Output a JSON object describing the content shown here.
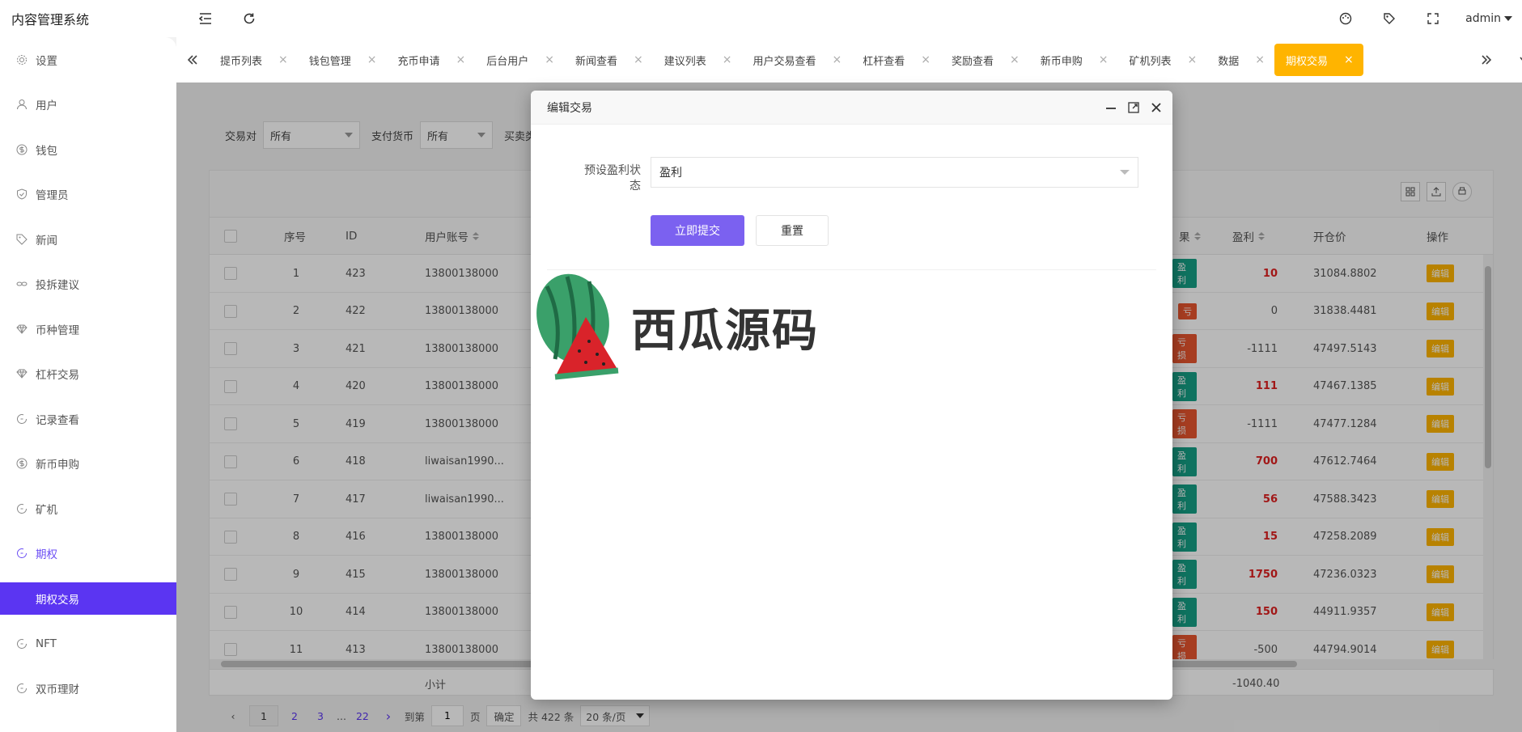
{
  "app": {
    "title": "内容管理系统",
    "user": "admin"
  },
  "sidebar": {
    "items": [
      {
        "label": "设置",
        "icon": "gear-icon"
      },
      {
        "label": "用户",
        "icon": "user-icon"
      },
      {
        "label": "钱包",
        "icon": "dollar-icon"
      },
      {
        "label": "管理员",
        "icon": "shield-icon"
      },
      {
        "label": "新闻",
        "icon": "tag-icon"
      },
      {
        "label": "投拆建议",
        "icon": "link-icon"
      },
      {
        "label": "币种管理",
        "icon": "diamond-icon"
      },
      {
        "label": "杠杆交易",
        "icon": "diamond-icon"
      },
      {
        "label": "记录查看",
        "icon": "history-icon"
      },
      {
        "label": "新币申购",
        "icon": "dollar-icon"
      },
      {
        "label": "矿机",
        "icon": "history-icon"
      },
      {
        "label": "期权",
        "icon": "history-icon"
      }
    ],
    "sub_active": "期权交易",
    "items_after": [
      {
        "label": "NFT",
        "icon": "history-icon"
      },
      {
        "label": "双币理财",
        "icon": "history-icon"
      }
    ]
  },
  "tabs": [
    {
      "label": "提币列表"
    },
    {
      "label": "钱包管理"
    },
    {
      "label": "充币申请"
    },
    {
      "label": "后台用户"
    },
    {
      "label": "新闻查看"
    },
    {
      "label": "建议列表"
    },
    {
      "label": "用户交易查看"
    },
    {
      "label": "杠杆查看"
    },
    {
      "label": "奖励查看"
    },
    {
      "label": "新币申购"
    },
    {
      "label": "矿机列表"
    },
    {
      "label": "数据"
    },
    {
      "label": "期权交易",
      "active": true
    }
  ],
  "filters": {
    "pair_label": "交易对",
    "pair_value": "所有",
    "currency_label": "支付货币",
    "currency_value": "所有",
    "type_label": "买卖类"
  },
  "table": {
    "columns": {
      "no": "序号",
      "id": "ID",
      "account": "用户账号",
      "result": "果",
      "profit": "盈利",
      "open_price": "开仓价",
      "action": "操作"
    },
    "edit_label": "编辑",
    "rows": [
      {
        "no": "1",
        "id": "423",
        "account": "13800138000",
        "result": "盈利",
        "profit": "10",
        "open": "31084.8802"
      },
      {
        "no": "2",
        "id": "422",
        "account": "13800138000",
        "result": "亏",
        "profit": "0",
        "open": "31838.4481"
      },
      {
        "no": "3",
        "id": "421",
        "account": "13800138000",
        "result": "亏损",
        "profit": "-1111",
        "open": "47497.5143"
      },
      {
        "no": "4",
        "id": "420",
        "account": "13800138000",
        "result": "盈利",
        "profit": "111",
        "open": "47467.1385"
      },
      {
        "no": "5",
        "id": "419",
        "account": "13800138000",
        "result": "亏损",
        "profit": "-1111",
        "open": "47477.1284"
      },
      {
        "no": "6",
        "id": "418",
        "account": "liwaisan1990...",
        "result": "盈利",
        "profit": "700",
        "open": "47612.7464"
      },
      {
        "no": "7",
        "id": "417",
        "account": "liwaisan1990...",
        "result": "盈利",
        "profit": "56",
        "open": "47588.3423"
      },
      {
        "no": "8",
        "id": "416",
        "account": "13800138000",
        "result": "盈利",
        "profit": "15",
        "open": "47258.2089"
      },
      {
        "no": "9",
        "id": "415",
        "account": "13800138000",
        "result": "盈利",
        "profit": "1750",
        "open": "47236.0323"
      },
      {
        "no": "10",
        "id": "414",
        "account": "13800138000",
        "result": "盈利",
        "profit": "150",
        "open": "44911.9357"
      },
      {
        "no": "11",
        "id": "413",
        "account": "13800138000",
        "result": "亏损",
        "profit": "-500",
        "open": "44794.9014"
      }
    ],
    "subtotal_label": "小计",
    "subtotal_profit": "-1040.40"
  },
  "pager": {
    "current": "1",
    "pages": [
      "2",
      "3"
    ],
    "ellipsis": "...",
    "last": "22",
    "goto_label": "到第",
    "goto_value": "1",
    "page_unit": "页",
    "confirm": "确定",
    "total": "共 422 条",
    "page_size": "20 条/页"
  },
  "modal": {
    "title": "编辑交易",
    "field_label": "预设盈利状态",
    "field_value": "盈利",
    "submit": "立即提交",
    "reset": "重置"
  },
  "watermark": {
    "text": "西瓜源码"
  },
  "colors": {
    "accent": "#5b35f2",
    "tab_active": "#ffb400",
    "win": "#16a085",
    "lose": "#e8552e",
    "profit": "#e02020"
  }
}
